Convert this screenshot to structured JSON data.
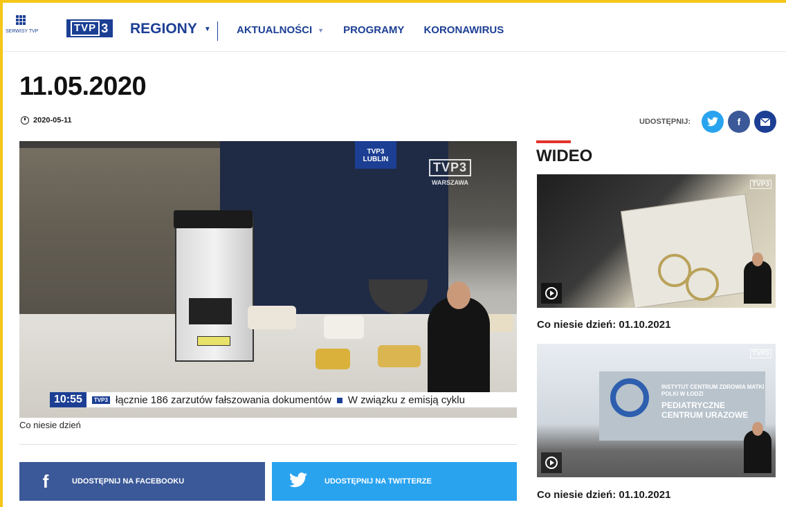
{
  "header": {
    "services_label": "SERWISY TVP",
    "logo_text": "TVP",
    "logo_number": "3",
    "section_title": "REGIONY",
    "nav": [
      {
        "label": "AKTUALNOŚCI",
        "has_dropdown": true
      },
      {
        "label": "PROGRAMY",
        "has_dropdown": false
      },
      {
        "label": "KORONAWIRUS",
        "has_dropdown": false
      }
    ]
  },
  "article": {
    "title": "11.05.2020",
    "date": "2020-05-11",
    "share_label": "UDOSTĘPNIJ:",
    "caption": "Co niesie dzień",
    "share_facebook": "UDOSTĘPNIJ NA FACEBOOKU",
    "share_twitter": "UDOSTĘPNIJ NA TWITTERZE"
  },
  "video": {
    "mic_label": "TVP3 LUBLIN",
    "watermark_logo": "TVP3",
    "watermark_city": "WARSZAWA",
    "ticker_time": "10:55",
    "ticker_logo": "TVP3",
    "ticker_text_1": "łącznie 186 zarzutów fałszowania dokumentów",
    "ticker_text_2": "W związku z emisją cyklu"
  },
  "sidebar": {
    "heading": "WIDEO",
    "items": [
      {
        "title": "Co niesie dzień: 01.10.2021",
        "watermark": "TVP3"
      },
      {
        "title": "Co niesie dzień: 01.10.2021",
        "watermark": "TVP3",
        "sign_line1": "INSTYTUT CENTRUM ZDROWIA MATKI POLKI W ŁODZI",
        "sign_line2": "PEDIATRYCZNE CENTRUM URAZOWE"
      }
    ]
  },
  "colors": {
    "brand": "#1c3f94",
    "frame": "#f5c518",
    "facebook": "#3b5998",
    "twitter": "#2aa3ef",
    "accent_red": "#e3322a"
  }
}
